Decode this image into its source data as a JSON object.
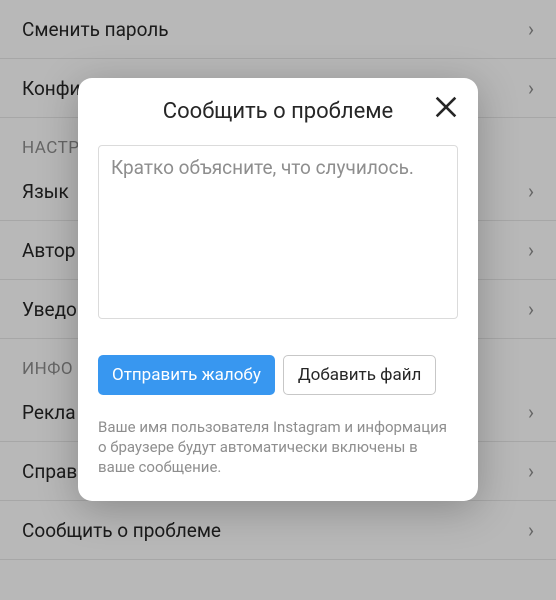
{
  "settings": {
    "items": [
      {
        "type": "item",
        "label": "Сменить пароль"
      },
      {
        "type": "item",
        "label": "Конфиденциальность и безопасность"
      },
      {
        "type": "header",
        "label": "НАСТР"
      },
      {
        "type": "item",
        "label": "Язык"
      },
      {
        "type": "item",
        "label": "Автор"
      },
      {
        "type": "item",
        "label": "Уведо"
      },
      {
        "type": "header",
        "label": "ИНФО"
      },
      {
        "type": "item",
        "label": "Рекла"
      },
      {
        "type": "item",
        "label": "Справ"
      },
      {
        "type": "item",
        "label": "Сообщить о проблеме"
      }
    ]
  },
  "modal": {
    "title": "Сообщить о проблеме",
    "placeholder": "Кратко объясните, что случилось.",
    "submit_label": "Отправить жалобу",
    "attach_label": "Добавить файл",
    "disclosure": "Ваше имя пользователя Instagram и информация о браузере будут автоматически включены в ваше сообщение."
  }
}
